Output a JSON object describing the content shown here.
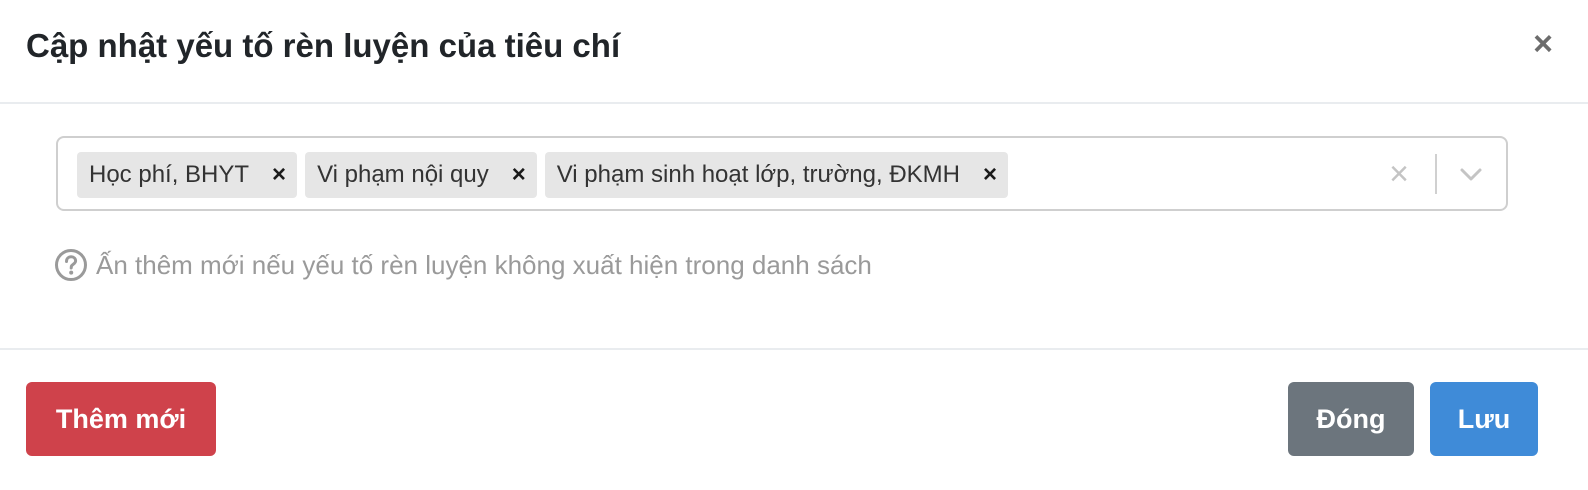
{
  "modal": {
    "title": "Cập nhật yếu tố rèn luyện của tiêu chí",
    "close_symbol": "×"
  },
  "select": {
    "selected_items": [
      {
        "label": "Học phí, BHYT"
      },
      {
        "label": "Vi phạm nội quy"
      },
      {
        "label": "Vi phạm sinh hoạt lớp, trường, ĐKMH"
      }
    ],
    "remove_symbol": "×",
    "clear_symbol": "×",
    "icons": {
      "clear": "clear-icon",
      "dropdown": "chevron-down-icon"
    }
  },
  "help_text": "Ấn thêm mới nếu yếu tố rèn luyện không xuất hiện trong danh sách",
  "footer": {
    "add_label": "Thêm mới",
    "close_label": "Đóng",
    "save_label": "Lưu"
  },
  "colors": {
    "add_button": "#cf424b",
    "close_button": "#6c757d",
    "save_button": "#3f8bd8",
    "chip_bg": "#e6e6e6",
    "help_text": "#9a9a9a"
  }
}
